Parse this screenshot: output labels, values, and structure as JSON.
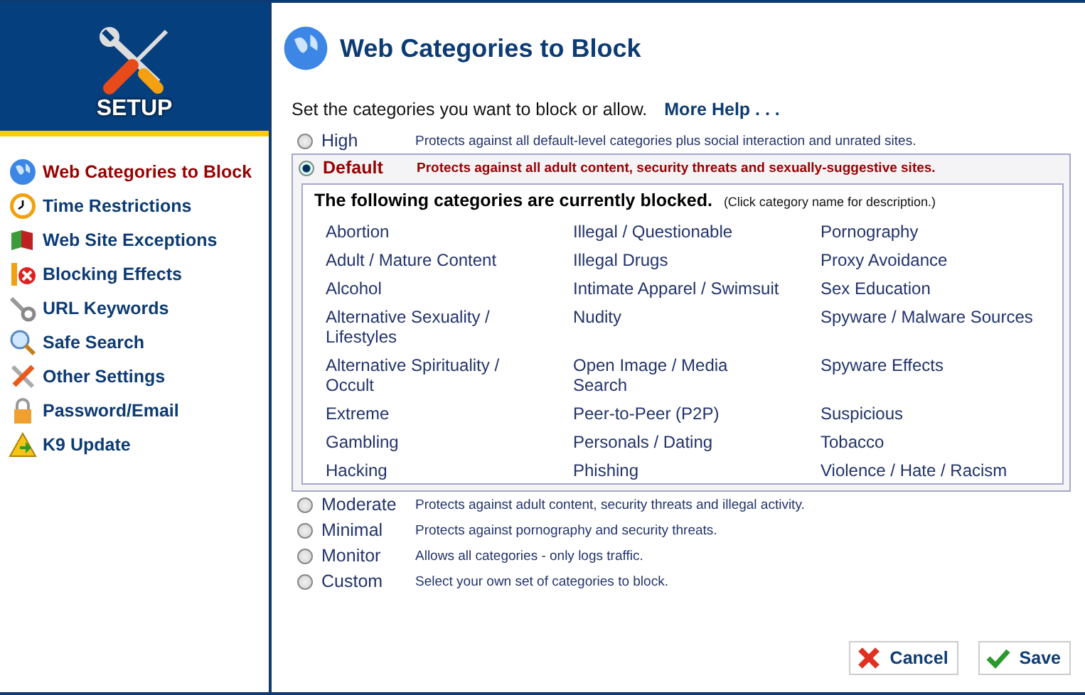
{
  "sidebar": {
    "title": "SETUP",
    "items": [
      {
        "label": "Web Categories to Block",
        "selected": true
      },
      {
        "label": "Time Restrictions",
        "selected": false
      },
      {
        "label": "Web Site Exceptions",
        "selected": false
      },
      {
        "label": "Blocking Effects",
        "selected": false
      },
      {
        "label": "URL Keywords",
        "selected": false
      },
      {
        "label": "Safe Search",
        "selected": false
      },
      {
        "label": "Other Settings",
        "selected": false
      },
      {
        "label": "Password/Email",
        "selected": false
      },
      {
        "label": "K9 Update",
        "selected": false
      }
    ]
  },
  "page": {
    "title": "Web Categories to Block",
    "intro": "Set the categories you want to block or allow.",
    "help_link": "More Help . . ."
  },
  "levels": [
    {
      "label": "High",
      "description": "Protects against all default-level categories plus social interaction and unrated sites.",
      "selected": false
    },
    {
      "label": "Default",
      "description": "Protects against all adult content, security threats and sexually-suggestive sites.",
      "selected": true,
      "blocked_heading": "The following categories are currently blocked.",
      "blocked_hint": "(Click category name for description.)",
      "categories": [
        "Abortion",
        "Illegal / Questionable",
        "Pornography",
        "Adult / Mature Content",
        "Illegal Drugs",
        "Proxy Avoidance",
        "Alcohol",
        "Intimate Apparel / Swimsuit",
        "Sex Education",
        "Alternative Sexuality / Lifestyles",
        "Nudity",
        "Spyware / Malware Sources",
        "Alternative Spirituality / Occult",
        "Open Image / Media Search",
        "Spyware Effects",
        "Extreme",
        "Peer-to-Peer (P2P)",
        "Suspicious",
        "Gambling",
        "Personals / Dating",
        "Tobacco",
        "Hacking",
        "Phishing",
        "Violence / Hate / Racism"
      ]
    },
    {
      "label": "Moderate",
      "description": "Protects against adult content, security threats and illegal activity.",
      "selected": false
    },
    {
      "label": "Minimal",
      "description": "Protects against pornography and security threats.",
      "selected": false
    },
    {
      "label": "Monitor",
      "description": "Allows all categories - only logs traffic.",
      "selected": false
    },
    {
      "label": "Custom",
      "description": "Select your own set of categories to block.",
      "selected": false
    }
  ],
  "buttons": [
    {
      "label": "Cancel",
      "kind": "cancel"
    },
    {
      "label": "Save",
      "kind": "save"
    }
  ]
}
